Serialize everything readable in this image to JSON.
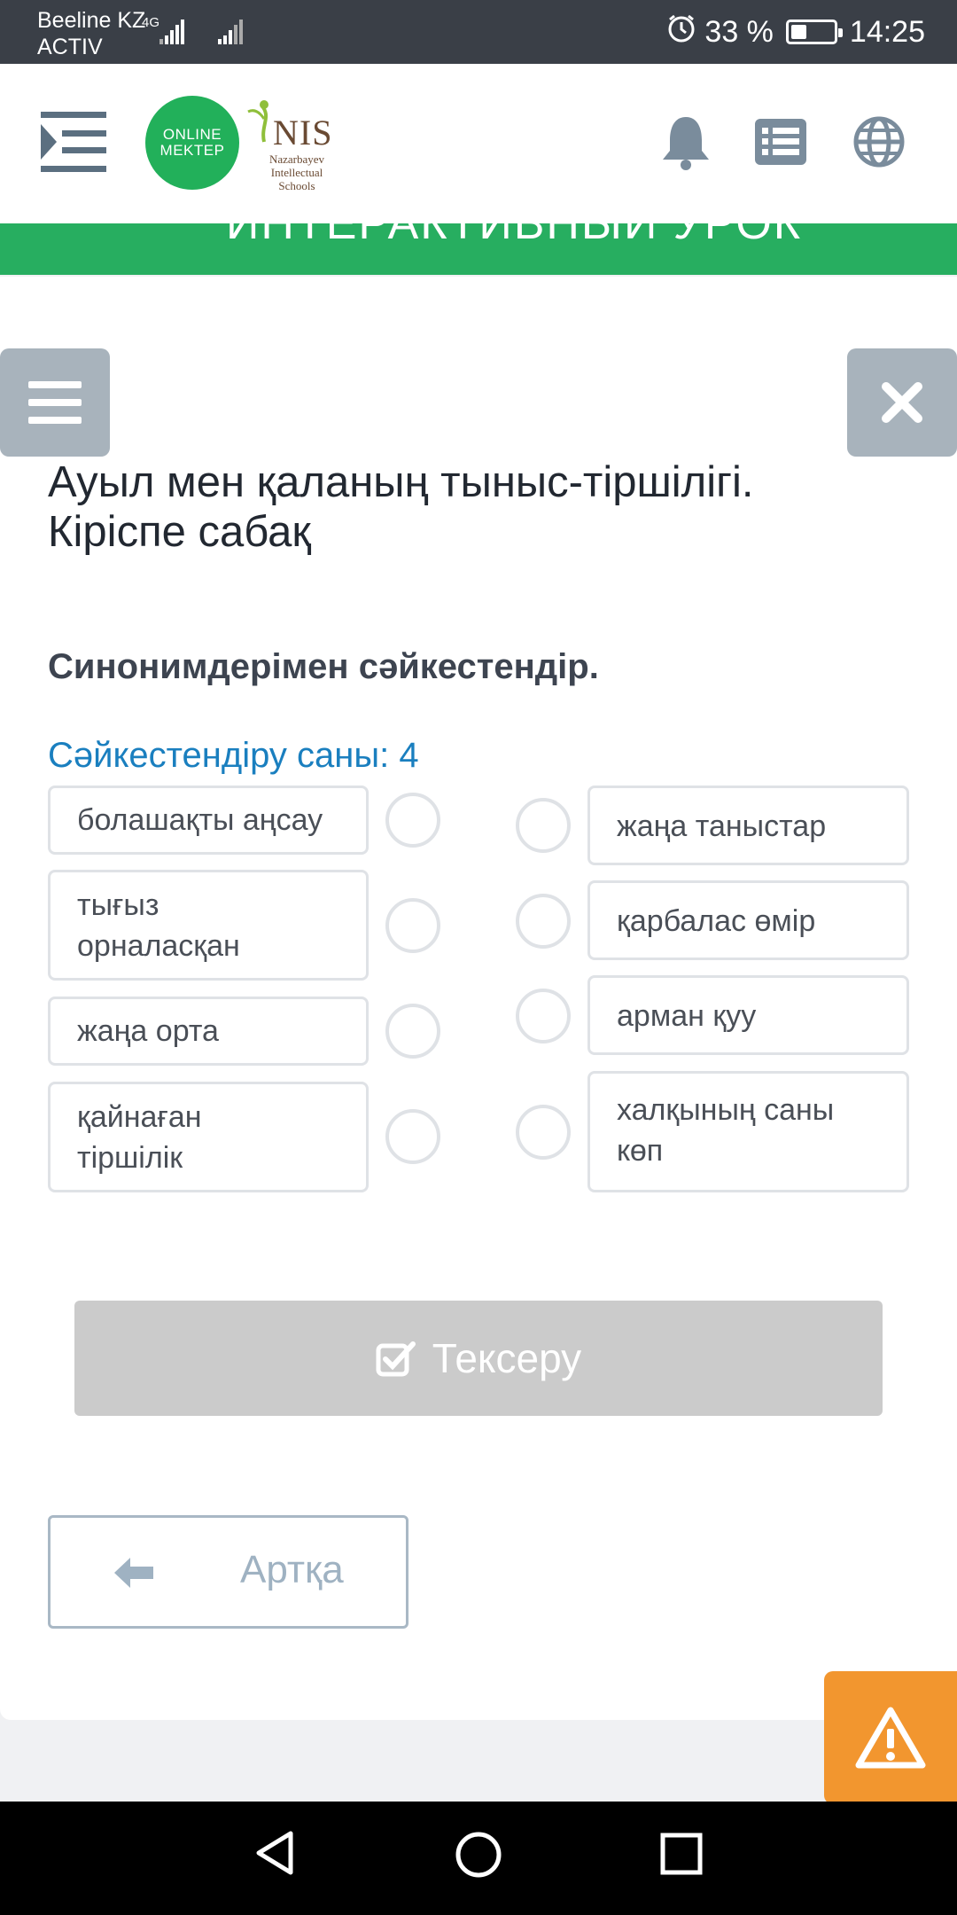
{
  "status_bar": {
    "carrier_line1": "Beeline KZ",
    "carrier_line2": "ACTIV",
    "network": "4G",
    "battery": "33 %",
    "time": "14:25"
  },
  "header": {
    "online_logo_line1": "ONLINE",
    "online_logo_line2": "MEKTEP",
    "nis_title": "NIS",
    "nis_subtitle": "Nazarbayev Intellectual Schools",
    "banner_text": "ИНТЕРАКТИВНЫЙ УРОК"
  },
  "lesson": {
    "title": "Ауыл мен қаланың тыныс-тіршілігі. Кіріспе сабақ",
    "task": "Синонимдерімен сәйкестендір.",
    "match_count_label": "Сәйкестендіру саны: 4"
  },
  "left_items": [
    {
      "label": "болашақты аңсау"
    },
    {
      "label": "тығыз орналасқан"
    },
    {
      "label": "жаңа орта"
    },
    {
      "label": "қайнаған тіршілік"
    }
  ],
  "right_items": [
    {
      "label": "жаңа таныстар"
    },
    {
      "label": "қарбалас өмір"
    },
    {
      "label": "арман қуу"
    },
    {
      "label": "халқының саны көп"
    }
  ],
  "buttons": {
    "check_label": "Тексеру",
    "back_label": "Артқа"
  },
  "colors": {
    "brand_green": "#27ae60",
    "accent_blue": "#1a7fbf",
    "warning_orange": "#f2962f",
    "disabled_gray": "#cbcbcb"
  }
}
